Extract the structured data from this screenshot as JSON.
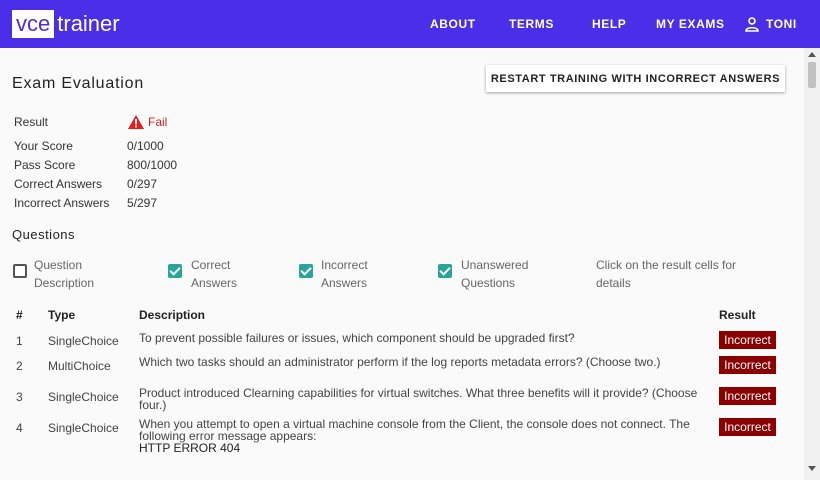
{
  "app": {
    "logo_box": "vce",
    "logo_word": "trainer"
  },
  "nav": {
    "items": [
      "ABOUT",
      "TERMS",
      "HELP",
      "MY EXAMS"
    ],
    "user": "TONI"
  },
  "page": {
    "title": "Exam Evaluation",
    "restart_button": "RESTART TRAINING WITH INCORRECT ANSWERS"
  },
  "summary": {
    "result_label": "Result",
    "result_value": "Fail",
    "your_score_label": "Your Score",
    "your_score": "0/1000",
    "pass_score_label": "Pass Score",
    "pass_score": "800/1000",
    "correct_label": "Correct Answers",
    "correct": "0/297",
    "incorrect_label": "Incorrect Answers",
    "incorrect": "5/297"
  },
  "questions": {
    "heading": "Questions",
    "filters": [
      {
        "label_line1": "Question",
        "label_line2": "Description",
        "checked": false
      },
      {
        "label_line1": "Correct",
        "label_line2": "Answers",
        "checked": true
      },
      {
        "label_line1": "Incorrect",
        "label_line2": "Answers",
        "checked": true
      },
      {
        "label_line1": "Unanswered",
        "label_line2": "Questions",
        "checked": true
      }
    ],
    "hint": "Click on the result cells for details",
    "columns": [
      "#",
      "Type",
      "Description",
      "Result"
    ],
    "rows": [
      {
        "num": "1",
        "type": "SingleChoice",
        "description": "To prevent possible failures or issues, which component should be upgraded first?",
        "result": "Incorrect"
      },
      {
        "num": "2",
        "type": "MultiChoice",
        "description": "Which two tasks should an administrator perform if the log reports metadata errors? (Choose two.)",
        "result": "Incorrect"
      },
      {
        "num": "3",
        "type": "SingleChoice",
        "description": "Product introduced Clearning capabilities for virtual switches. What three benefits will it provide? (Choose four.)",
        "result": "Incorrect"
      },
      {
        "num": "4",
        "type": "SingleChoice",
        "description": "When you attempt to open a virtual machine console from the Client, the console does not connect. The following error message appears:",
        "description_extra": "HTTP ERROR 404",
        "result": "Incorrect"
      }
    ]
  },
  "colors": {
    "topbar": "#4a2ee8",
    "fail": "#e02020",
    "badge": "#8b0000",
    "checkbox": "#26a69a"
  }
}
